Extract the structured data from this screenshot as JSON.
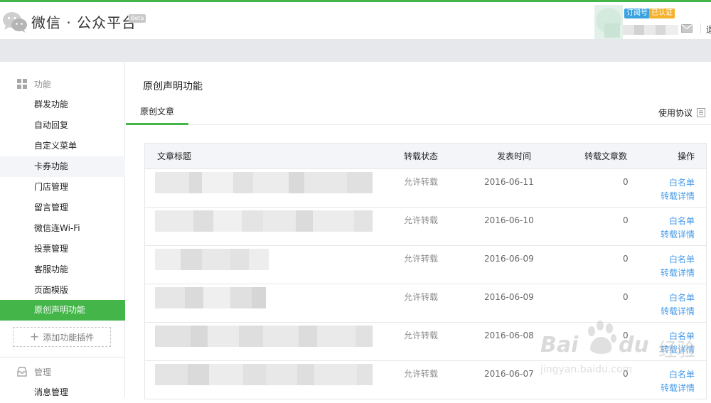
{
  "header": {
    "title": "微信 · 公众平台",
    "beta": "Beta",
    "tag_type": "订阅号",
    "tag_verified": "已认证",
    "exit": "退出"
  },
  "sidebar": {
    "section1": "功能",
    "items": [
      {
        "label": "群发功能",
        "state": "normal"
      },
      {
        "label": "自动回复",
        "state": "normal"
      },
      {
        "label": "自定义菜单",
        "state": "normal"
      },
      {
        "label": "卡券功能",
        "state": "hover"
      },
      {
        "label": "门店管理",
        "state": "normal"
      },
      {
        "label": "留言管理",
        "state": "normal"
      },
      {
        "label": "微信连Wi-Fi",
        "state": "normal"
      },
      {
        "label": "投票管理",
        "state": "normal"
      },
      {
        "label": "客服功能",
        "state": "normal"
      },
      {
        "label": "页面模版",
        "state": "normal"
      },
      {
        "label": "原创声明功能",
        "state": "active"
      }
    ],
    "add_plugin": "添加功能插件",
    "section2": "管理",
    "section2_items": [
      {
        "label": "消息管理"
      }
    ]
  },
  "main": {
    "page_title": "原创声明功能",
    "tab": "原创文章",
    "agreement": "使用协议",
    "columns": [
      "文章标题",
      "转载状态",
      "发表时间",
      "转载文章数",
      "操作"
    ],
    "rows": [
      {
        "status": "允许转载",
        "date": "2016-06-11",
        "count": "0",
        "op1": "白名单",
        "op2": "转载详情"
      },
      {
        "status": "允许转载",
        "date": "2016-06-10",
        "count": "0",
        "op1": "白名单",
        "op2": "转载详情"
      },
      {
        "status": "允许转载",
        "date": "2016-06-09",
        "count": "0",
        "op1": "白名单",
        "op2": "转载详情"
      },
      {
        "status": "允许转载",
        "date": "2016-06-09",
        "count": "0",
        "op1": "白名单",
        "op2": "转载详情"
      },
      {
        "status": "允许转载",
        "date": "2016-06-08",
        "count": "0",
        "op1": "白名单",
        "op2": "转载详情"
      },
      {
        "status": "允许转载",
        "date": "2016-06-07",
        "count": "0",
        "op1": "白名单",
        "op2": "转载详情"
      }
    ]
  },
  "watermark": {
    "brand_latin": "Bai",
    "brand_du": "du",
    "brand_cn": "经验",
    "url": "jingyan.baidu.com"
  },
  "colors": {
    "brand_green": "#44b549",
    "link_blue": "#459ae9",
    "gray_bar": "#e7e8eb"
  }
}
